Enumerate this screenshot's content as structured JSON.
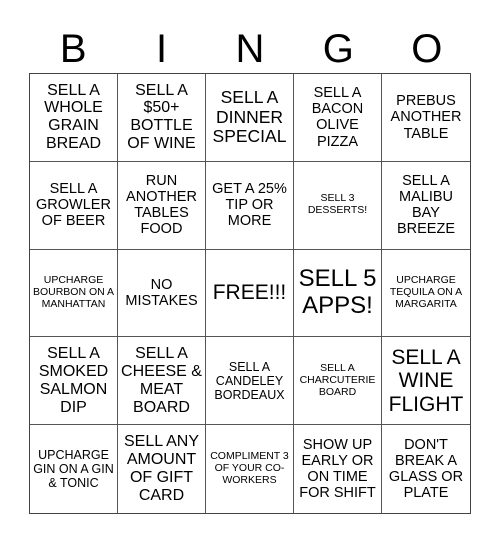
{
  "header": {
    "letters": [
      "B",
      "I",
      "N",
      "G",
      "O"
    ]
  },
  "board": {
    "rows": [
      [
        "SELL A WHOLE GRAIN BREAD",
        "SELL A $50+ BOTTLE OF WINE",
        "SELL A DINNER SPECIAL",
        "SELL A BACON OLIVE PIZZA",
        "PREBUS ANOTHER TABLE"
      ],
      [
        "SELL A GROWLER OF BEER",
        "RUN ANOTHER TABLES FOOD",
        "GET A 25% TIP OR MORE",
        "SELL 3 DESSERTS!",
        "SELL A MALIBU BAY BREEZE"
      ],
      [
        "UPCHARGE BOURBON ON A MANHATTAN",
        "NO MISTAKES",
        "FREE!!!",
        "SELL 5 APPS!",
        "UPCHARGE TEQUILA ON A MARGARITA"
      ],
      [
        "SELL A SMOKED SALMON DIP",
        "SELL A CHEESE & MEAT BOARD",
        "SELL A CANDELEY BORDEAUX",
        "SELL A CHARCUTERIE BOARD",
        "SELL A WINE FLIGHT"
      ],
      [
        "UPCHARGE GIN ON A GIN & TONIC",
        "SELL ANY AMOUNT OF GIFT CARD",
        "COMPLIMENT 3 OF YOUR CO-WORKERS",
        "SHOW UP EARLY OR ON TIME FOR SHIFT",
        "DON'T BREAK A GLASS OR PLATE"
      ]
    ]
  }
}
